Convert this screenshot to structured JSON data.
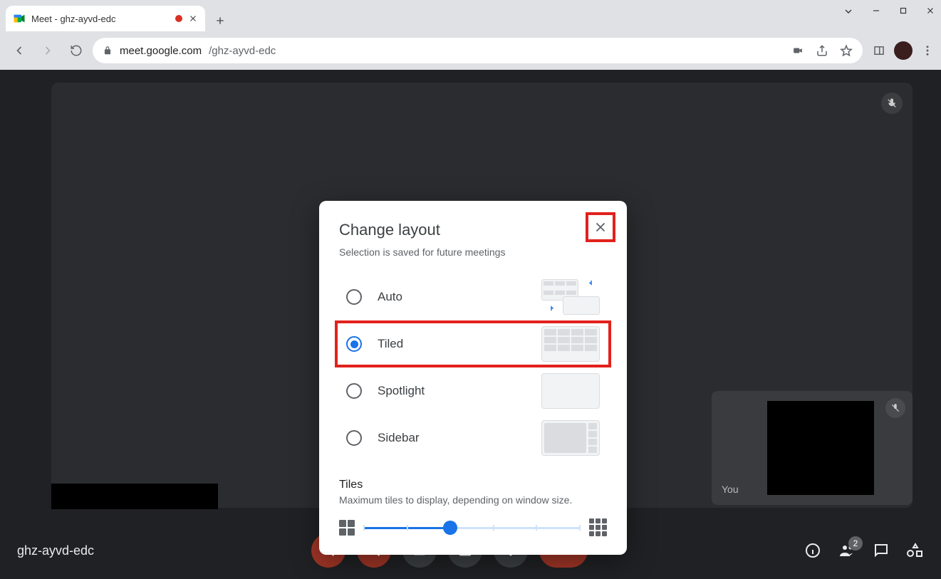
{
  "browser": {
    "tab_title": "Meet - ghz-ayvd-edc",
    "url_host": "meet.google.com",
    "url_path": "/ghz-ayvd-edc"
  },
  "meet": {
    "code": "ghz-ayvd-edc",
    "pip_label": "You",
    "participant_badge": "2"
  },
  "dialog": {
    "title": "Change layout",
    "subtitle": "Selection is saved for future meetings",
    "options": [
      {
        "id": "auto",
        "label": "Auto",
        "selected": false
      },
      {
        "id": "tiled",
        "label": "Tiled",
        "selected": true
      },
      {
        "id": "spotlight",
        "label": "Spotlight",
        "selected": false
      },
      {
        "id": "sidebar",
        "label": "Sidebar",
        "selected": false
      }
    ],
    "slider_title": "Tiles",
    "slider_sub": "Maximum tiles to display, depending on window size.",
    "slider_value_pct": 40
  },
  "highlights": {
    "close_button": true,
    "tiled_row": true
  }
}
